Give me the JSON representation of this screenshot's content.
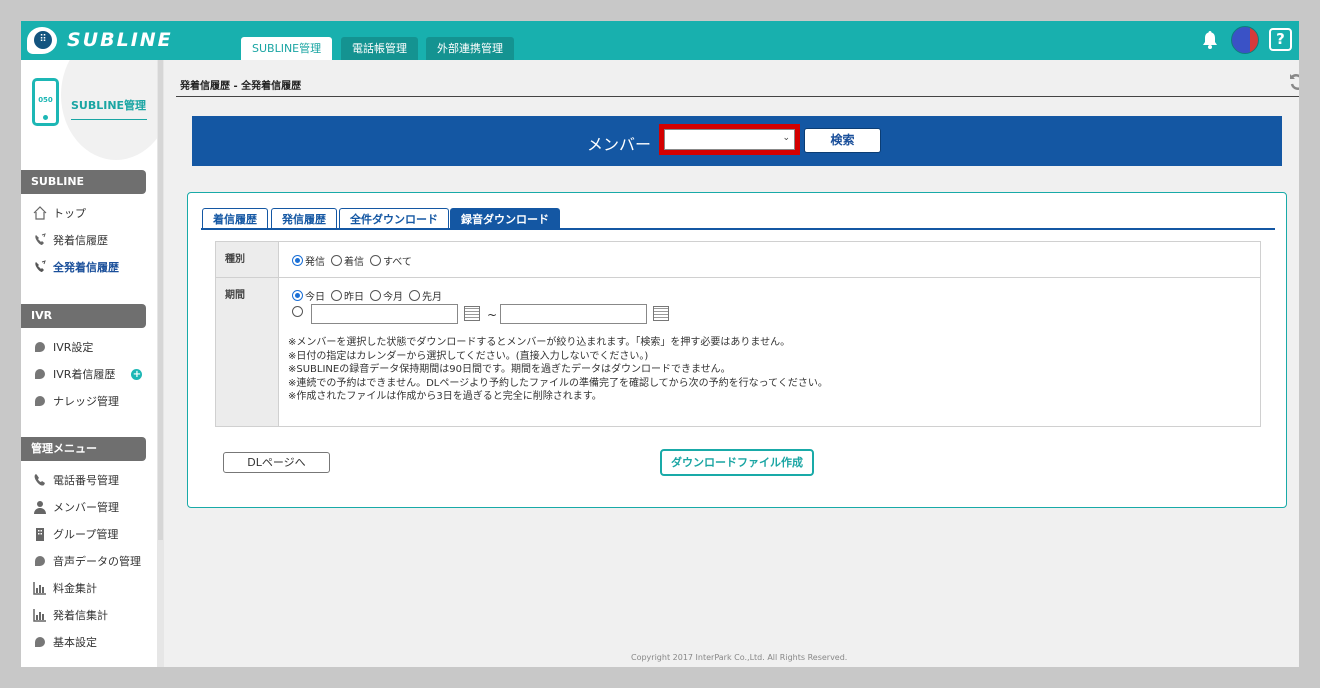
{
  "header": {
    "logo_text": "SUBLINE",
    "tabs": [
      {
        "label": "SUBLINE管理",
        "active": true
      },
      {
        "label": "電話帳管理",
        "active": false
      },
      {
        "label": "外部連携管理",
        "active": false
      }
    ],
    "help_label": "?",
    "accent_color": "#18b0ae"
  },
  "sidebar": {
    "brand_title": "SUBLINE管理",
    "phone_badge": "050",
    "sections": [
      {
        "title": "SUBLINE",
        "items": [
          {
            "label": "トップ",
            "icon": "home-icon"
          },
          {
            "label": "発着信履歴",
            "icon": "phone-call-icon"
          },
          {
            "label": "全発着信履歴",
            "icon": "phone-call-icon",
            "active": true
          }
        ]
      },
      {
        "title": "IVR",
        "items": [
          {
            "label": "IVR設定",
            "icon": "bubble-icon"
          },
          {
            "label": "IVR着信履歴",
            "icon": "bubble-icon",
            "badge": "+"
          },
          {
            "label": "ナレッジ管理",
            "icon": "bubble-icon"
          }
        ]
      },
      {
        "title": "管理メニュー",
        "items": [
          {
            "label": "電話番号管理",
            "icon": "phone-icon"
          },
          {
            "label": "メンバー管理",
            "icon": "person-icon"
          },
          {
            "label": "グループ管理",
            "icon": "building-icon"
          },
          {
            "label": "音声データの管理",
            "icon": "bubble-icon"
          },
          {
            "label": "料金集計",
            "icon": "bar-chart-icon"
          },
          {
            "label": "発着信集計",
            "icon": "bar-chart-icon"
          },
          {
            "label": "基本設定",
            "icon": "bubble-icon"
          }
        ]
      }
    ]
  },
  "main": {
    "breadcrumb": "発着信履歴 - 全発着信履歴",
    "search": {
      "member_label": "メンバー",
      "member_selected": "",
      "search_button": "検索"
    },
    "tabs": [
      {
        "label": "着信履歴",
        "active": false
      },
      {
        "label": "発信履歴",
        "active": false
      },
      {
        "label": "全件ダウンロード",
        "active": false
      },
      {
        "label": "録音ダウンロード",
        "active": true
      }
    ],
    "form": {
      "type_label": "種別",
      "type_options": [
        {
          "label": "発信",
          "checked": true
        },
        {
          "label": "着信",
          "checked": false
        },
        {
          "label": "すべて",
          "checked": false
        }
      ],
      "period_label": "期間",
      "period_options": [
        {
          "label": "今日",
          "checked": true
        },
        {
          "label": "昨日",
          "checked": false
        },
        {
          "label": "今月",
          "checked": false
        },
        {
          "label": "先月",
          "checked": false
        }
      ],
      "date_from": "",
      "date_to": "",
      "range_separator": "~",
      "notes": [
        "※メンバーを選択した状態でダウンロードするとメンバーが絞り込まれます。「検索」を押す必要はありません。",
        "※日付の指定はカレンダーから選択してください。(直接入力しないでください。)",
        "※SUBLINEの録音データ保持期間は90日間です。期間を過ぎたデータはダウンロードできません。",
        "※連続での予約はできません。DLページより予約したファイルの準備完了を確認してから次の予約を行なってください。",
        "※作成されたファイルは作成から3日を過ぎると完全に削除されます。"
      ]
    },
    "buttons": {
      "dl_page": "DLページへ",
      "create_file": "ダウンロードファイル作成"
    },
    "copyright": "Copyright 2017 InterPark Co.,Ltd. All Rights Reserved."
  }
}
